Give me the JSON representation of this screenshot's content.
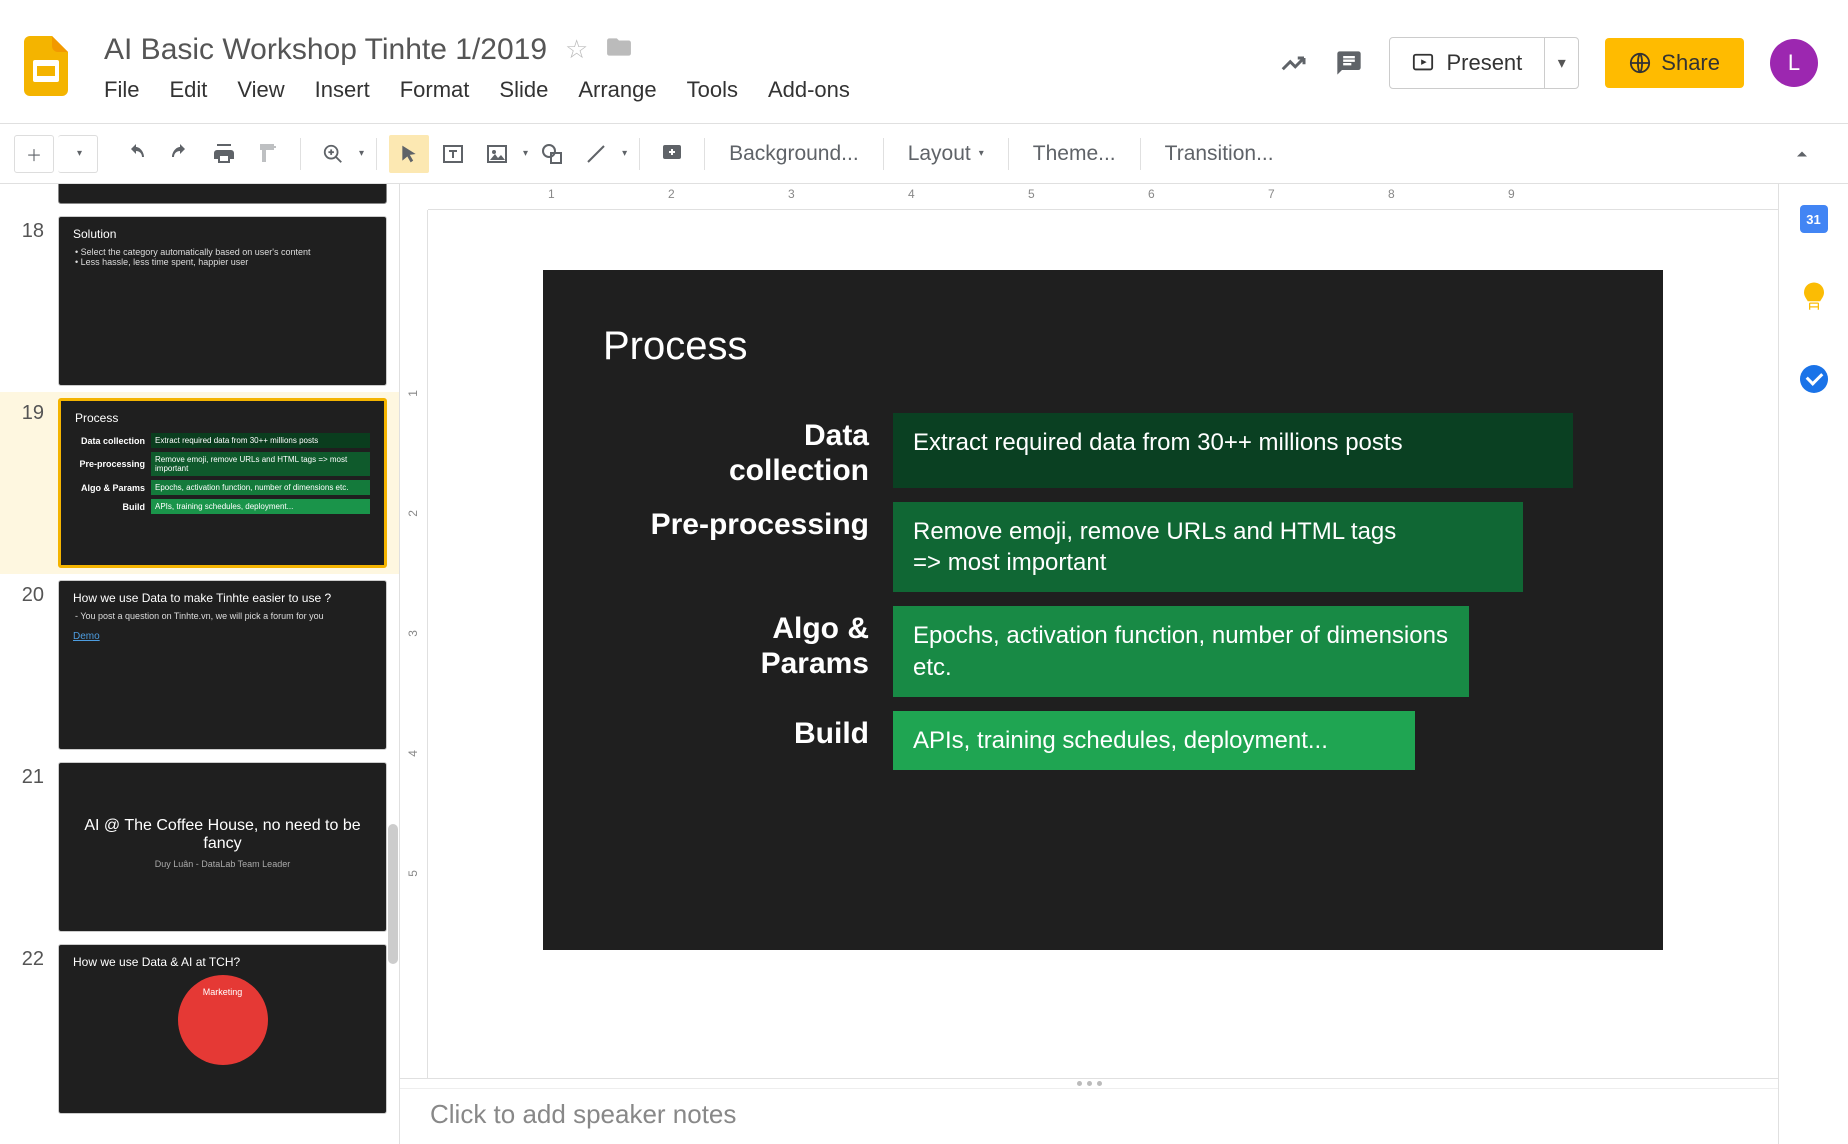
{
  "doc": {
    "title": "AI Basic Workshop Tinhte 1/2019"
  },
  "menu": {
    "file": "File",
    "edit": "Edit",
    "view": "View",
    "insert": "Insert",
    "format": "Format",
    "slide": "Slide",
    "arrange": "Arrange",
    "tools": "Tools",
    "addons": "Add-ons"
  },
  "header": {
    "present": "Present",
    "share": "Share",
    "avatar": "L"
  },
  "toolbar": {
    "background": "Background...",
    "layout": "Layout",
    "theme": "Theme...",
    "transition": "Transition..."
  },
  "ruler_h": [
    "1",
    "2",
    "3",
    "4",
    "5",
    "6",
    "7",
    "8",
    "9"
  ],
  "ruler_v": [
    "1",
    "2",
    "3",
    "4",
    "5"
  ],
  "thumbs": {
    "s18": {
      "num": "18",
      "title": "Solution",
      "b1": "Select the category automatically based on user's content",
      "b2": "Less hassle, less time spent, happier user"
    },
    "s19": {
      "num": "19",
      "title": "Process",
      "r1l": "Data collection",
      "r1": "Extract required data from 30++ millions posts",
      "r2l": "Pre-processing",
      "r2": "Remove emoji, remove URLs and HTML tags => most important",
      "r3l": "Algo & Params",
      "r3": "Epochs, activation function, number of dimensions etc.",
      "r4l": "Build",
      "r4": "APIs, training schedules, deployment..."
    },
    "s20": {
      "num": "20",
      "title": "How we use Data to make Tinhte easier to use ?",
      "b1": "You post a question on Tinhte.vn, we will pick a forum for you",
      "link": "Demo"
    },
    "s21": {
      "num": "21",
      "title": "AI @ The Coffee House, no need to be fancy",
      "sub": "Duy Luân - DataLab Team Leader"
    },
    "s22": {
      "num": "22",
      "title": "How we use Data & AI at TCH?",
      "circle": "Marketing"
    }
  },
  "slide": {
    "title": "Process",
    "rows": {
      "r1l": "Data collection",
      "r1": "Extract required data from 30++ millions posts",
      "r2l": "Pre-processing",
      "r2": "Remove emoji, remove URLs and HTML tags => most important",
      "r3l": "Algo & Params",
      "r3": "Epochs, activation function, number of dimensions etc.",
      "r4l": "Build",
      "r4": "APIs, training schedules, deployment..."
    }
  },
  "notes": {
    "placeholder": "Click to add speaker notes"
  },
  "sidepanel": {
    "cal": "31"
  }
}
